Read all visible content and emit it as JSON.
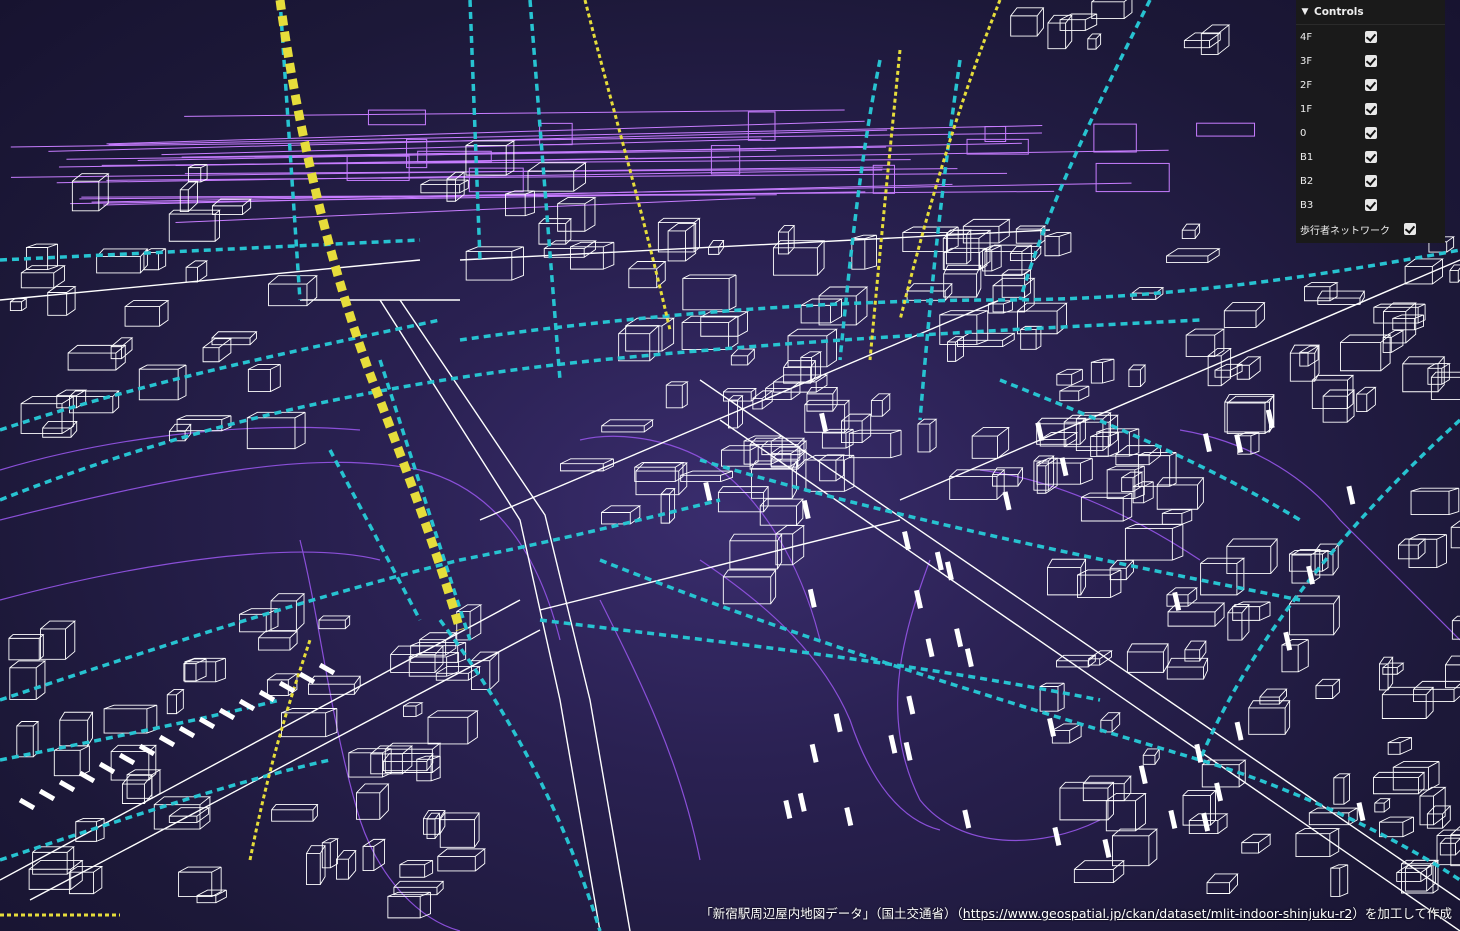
{
  "controls": {
    "title": "Controls",
    "layers": [
      {
        "label": "4F",
        "checked": true
      },
      {
        "label": "3F",
        "checked": true
      },
      {
        "label": "2F",
        "checked": true
      },
      {
        "label": "1F",
        "checked": true
      },
      {
        "label": "0",
        "checked": true
      },
      {
        "label": "B1",
        "checked": true
      },
      {
        "label": "B2",
        "checked": true
      },
      {
        "label": "B3",
        "checked": true
      }
    ],
    "network": {
      "label": "歩行者ネットワーク",
      "checked": true
    }
  },
  "attribution": {
    "prefix": "「新宿駅周辺屋内地図データ」（国土交通省）（",
    "link_text": "https://www.geospatial.jp/ckan/dataset/mlit-indoor-shinjuku-r2",
    "suffix": "）を加工して作成"
  },
  "colors": {
    "background": "#231c46",
    "floor_white": "#ffffff",
    "upper_magenta": "#c77dff",
    "network_cyan": "#27c3d1",
    "network_yellow": "#e6dd3b",
    "purple_lines": "#8a4fd8"
  }
}
